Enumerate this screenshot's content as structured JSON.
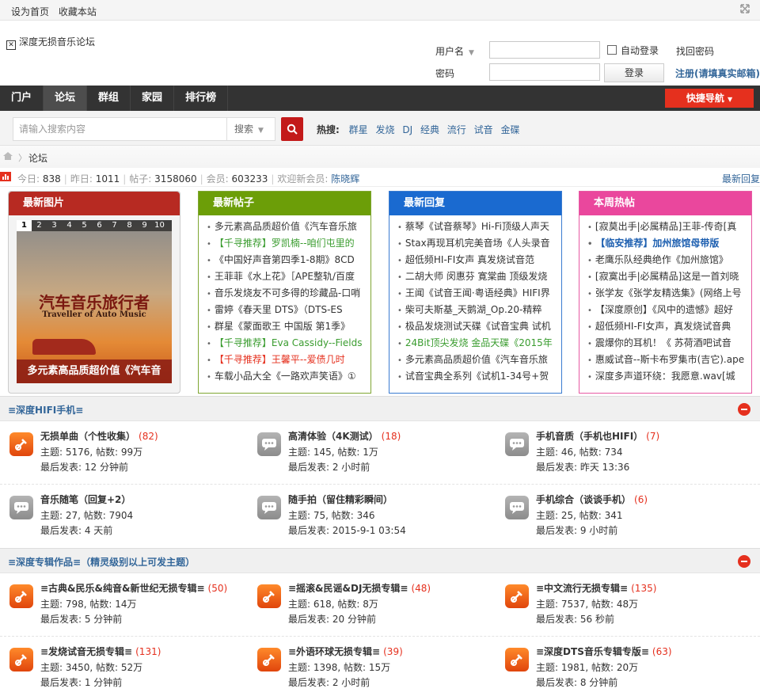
{
  "topbar": {
    "set_home": "设为首页",
    "bookmark": "收藏本站"
  },
  "logo": {
    "alt": "深度无损音乐论坛"
  },
  "login": {
    "username_label": "用户名",
    "password_label": "密码",
    "auto_login": "自动登录",
    "find_password": "找回密码",
    "login_button": "登录",
    "register": "注册(请填真实邮箱)"
  },
  "nav": {
    "items": [
      "门户",
      "论坛",
      "群组",
      "家园",
      "排行榜"
    ],
    "quick_nav": "快捷导航"
  },
  "search": {
    "placeholder": "请输入搜索内容",
    "type": "搜索",
    "hot_label": "热搜:",
    "hot_terms": [
      "群星",
      "发烧",
      "DJ",
      "经典",
      "流行",
      "试音",
      "金碟"
    ]
  },
  "breadcrumb": {
    "current": "论坛"
  },
  "stats": {
    "today_label": "今日:",
    "today": "838",
    "yesterday_label": "昨日:",
    "yesterday": "1011",
    "posts_label": "帖子:",
    "posts": "3158060",
    "members_label": "会员:",
    "members": "603233",
    "welcome_label": "欢迎新会员:",
    "new_member": "陈晓辉",
    "latest_reply": "最新回复"
  },
  "portal": {
    "pics": {
      "title": "最新图片",
      "numbers": [
        "1",
        "2",
        "3",
        "4",
        "5",
        "6",
        "7",
        "8",
        "9",
        "10"
      ],
      "banner_title": "汽车音乐旅行者",
      "banner_sub": "Traveller of Auto Music",
      "caption": "多元素高品质超价值《汽车音"
    },
    "posts": {
      "title": "最新帖子",
      "items": [
        "多元素高品质超价值《汽车音乐旅",
        "【千寻推荐】罗凯楠--咱们屯里的",
        "《中国好声音第四季1-8期》8CD",
        "王菲菲《水上花》［APE整轨/百度",
        "音乐发烧友不可多得的珍藏品-口哨",
        "雷婷《春天里 DTS》（DTS-ES",
        "群星《蒙面歌王 中国版 第1季》",
        "【千寻推荐】Eva Cassidy--Fields",
        "【千寻推荐】王馨平--爱债几时",
        "车载小品大全《一路欢声笑语》①"
      ]
    },
    "replies": {
      "title": "最新回复",
      "items": [
        "蔡琴《试音蔡琴》Hi-Fi顶级人声天",
        "Stax再现耳机完美音场《人头录音",
        "超低频HI-FI女声 真发烧试音范",
        "二胡大师 闵惠芬 寛棠曲 顶级发烧",
        "王闻《试音王闻·粤语经典》HIFI界",
        "柴可夫斯基_天鹅湖_Op.20-精粹",
        "极品发烧测试天碟《试音宝典 试机",
        "24Bit顶尖发烧 金品天碟《2015年",
        "多元素高品质超价值《汽车音乐旅",
        "试音宝典全系列《试机1-34号+贺"
      ]
    },
    "weekly": {
      "title": "本周热帖",
      "items": [
        "[寂莫出手|必属精品]王菲-传奇[真",
        "【临安推荐】加州旅馆母带版",
        "老鹰乐队经典绝作《加州旅馆》",
        "[寂寞出手|必属精品]这是一首刘晓",
        "张学友《张学友精选集》(网络上号",
        "【深度原创】《风中的遗憾》超好",
        "超低频HI-FI女声，真发烧试音典",
        "震爆你的耳机！《 苏荷酒吧试音",
        "惠威试音--斯卡布罗集市(吉它).ape",
        "深度多声道环绕：我愿意.wav[城"
      ]
    }
  },
  "groups": [
    {
      "title": "≡深度HIFI手机≡",
      "forums": [
        {
          "name": "无损单曲（个性收集）",
          "count": "(82)",
          "icon": "hot",
          "meta": "主题: 5176, 帖数: 99万",
          "last": "最后发表: 12 分钟前"
        },
        {
          "name": "高清体验（4K测试）",
          "count": "(18)",
          "icon": "norm",
          "meta": "主题: 145, 帖数: 1万",
          "last": "最后发表: 2 小时前"
        },
        {
          "name": "手机音质（手机也HIFI）",
          "count": "(7)",
          "icon": "norm",
          "meta": "主题: 46, 帖数: 734",
          "last": "最后发表: 昨天 13:36"
        },
        {
          "name": "音乐随笔（回复+2）",
          "count": "",
          "icon": "norm",
          "meta": "主题: 27, 帖数: 7904",
          "last": "最后发表: 4 天前"
        },
        {
          "name": "随手拍（留住精彩瞬间）",
          "count": "",
          "icon": "norm",
          "meta": "主题: 75, 帖数: 346",
          "last": "最后发表: 2015-9-1 03:54"
        },
        {
          "name": "手机综合（谈谈手机）",
          "count": "(6)",
          "icon": "norm",
          "meta": "主题: 25, 帖数: 341",
          "last": "最后发表: 9 小时前"
        }
      ]
    },
    {
      "title": "≡深度专辑作品≡（精灵级别以上可发主题）",
      "forums": [
        {
          "name": "≡古典&民乐&纯音&新世纪无损专辑≡",
          "count": "(50)",
          "icon": "hot",
          "meta": "主题: 798, 帖数: 14万",
          "last": "最后发表: 5 分钟前"
        },
        {
          "name": "≡摇滚&民谣&DJ无损专辑≡",
          "count": "(48)",
          "icon": "hot",
          "meta": "主题: 618, 帖数: 8万",
          "last": "最后发表: 20 分钟前"
        },
        {
          "name": "≡中文流行无损专辑≡",
          "count": "(135)",
          "icon": "hot",
          "meta": "主题: 7537, 帖数: 48万",
          "last": "最后发表: 56 秒前"
        },
        {
          "name": "≡发烧试音无损专辑≡",
          "count": "(131)",
          "icon": "hot",
          "meta": "主题: 3450, 帖数: 52万",
          "last": "最后发表: 1 分钟前"
        },
        {
          "name": "≡外语环球无损专辑≡",
          "count": "(39)",
          "icon": "hot",
          "meta": "主题: 1398, 帖数: 15万",
          "last": "最后发表: 2 小时前"
        },
        {
          "name": "≡深度DTS音乐专辑专版≡",
          "count": "(63)",
          "icon": "hot",
          "meta": "主题: 1981, 帖数: 20万",
          "last": "最后发表: 8 分钟前"
        }
      ]
    }
  ]
}
